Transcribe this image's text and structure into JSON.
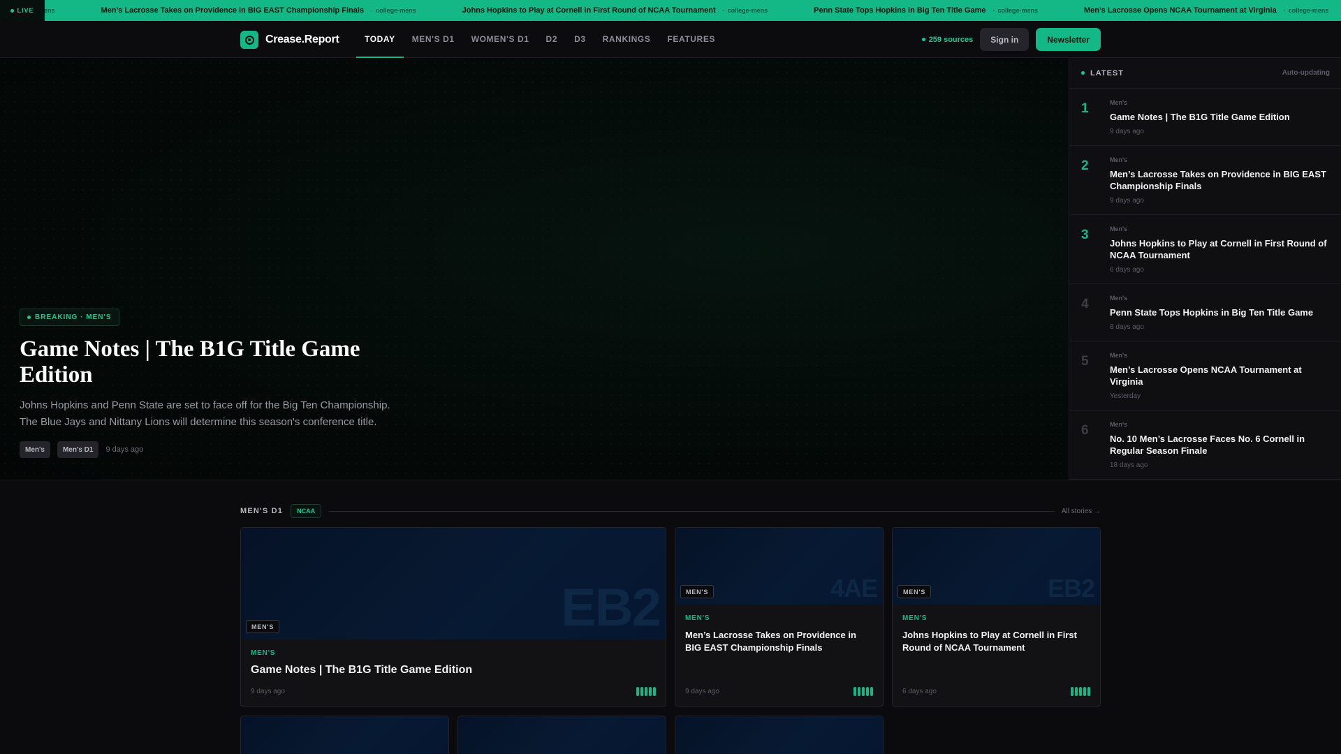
{
  "ticker": {
    "live_label": "LIVE",
    "items": [
      {
        "title": "",
        "source": "college-mens"
      },
      {
        "title": "Men’s Lacrosse Takes on Providence in BIG EAST Championship Finals",
        "source": "college-mens"
      },
      {
        "title": "Johns Hopkins to Play at Cornell in First Round of NCAA Tournament",
        "source": "college-mens"
      },
      {
        "title": "Penn State Tops Hopkins in Big Ten Title Game",
        "source": "college-mens"
      },
      {
        "title": "Men’s Lacrosse Opens NCAA Tournament at Virginia",
        "source": "college-mens"
      }
    ]
  },
  "nav": {
    "brand": "Crease.Report",
    "links": [
      "TODAY",
      "MEN'S D1",
      "WOMEN'S D1",
      "D2",
      "D3",
      "RANKINGS",
      "FEATURES"
    ],
    "active": "TODAY",
    "sources": "259 sources",
    "signin": "Sign in",
    "newsletter": "Newsletter"
  },
  "hero": {
    "badge": "BREAKING · MEN'S",
    "title": "Game Notes | The B1G Title Game Edition",
    "dek": "Johns Hopkins and Penn State are set to face off for the Big Ten Championship. The Blue Jays and Nittany Lions will determine this season's conference title.",
    "tags": [
      "Men's",
      "Men's D1"
    ],
    "time": "9 days ago"
  },
  "latest": {
    "title": "LATEST",
    "status": "Auto-updating",
    "items": [
      {
        "num": "1",
        "cat": "Men's",
        "headline": "Game Notes | The B1G Title Game Edition",
        "time": "9 days ago"
      },
      {
        "num": "2",
        "cat": "Men's",
        "headline": "Men’s Lacrosse Takes on Providence in BIG EAST Championship Finals",
        "time": "9 days ago"
      },
      {
        "num": "3",
        "cat": "Men's",
        "headline": "Johns Hopkins to Play at Cornell in First Round of NCAA Tournament",
        "time": "6 days ago"
      },
      {
        "num": "4",
        "cat": "Men's",
        "headline": "Penn State Tops Hopkins in Big Ten Title Game",
        "time": "8 days ago"
      },
      {
        "num": "5",
        "cat": "Men's",
        "headline": "Men’s Lacrosse Opens NCAA Tournament at Virginia",
        "time": "Yesterday"
      },
      {
        "num": "6",
        "cat": "Men's",
        "headline": "No. 10 Men’s Lacrosse Faces No. 6 Cornell in Regular Season Finale",
        "time": "18 days ago"
      }
    ]
  },
  "section": {
    "title": "MEN'S D1",
    "pill": "NCAA",
    "link": "All stories →",
    "cards": [
      {
        "code": "EB2",
        "tag": "MEN'S",
        "cat": "MEN'S",
        "title": "Game Notes | The B1G Title Game Edition",
        "time": "9 days ago"
      },
      {
        "code": "4AE",
        "tag": "MEN'S",
        "cat": "MEN'S",
        "title": "Men’s Lacrosse Takes on Providence in BIG EAST Championship Finals",
        "time": "9 days ago"
      },
      {
        "code": "EB2",
        "tag": "MEN'S",
        "cat": "MEN'S",
        "title": "Johns Hopkins to Play at Cornell in First Round of NCAA Tournament",
        "time": "6 days ago"
      }
    ]
  },
  "colors": {
    "accent": "#14b886",
    "background": "#0b0b0d",
    "card": "#121215"
  }
}
